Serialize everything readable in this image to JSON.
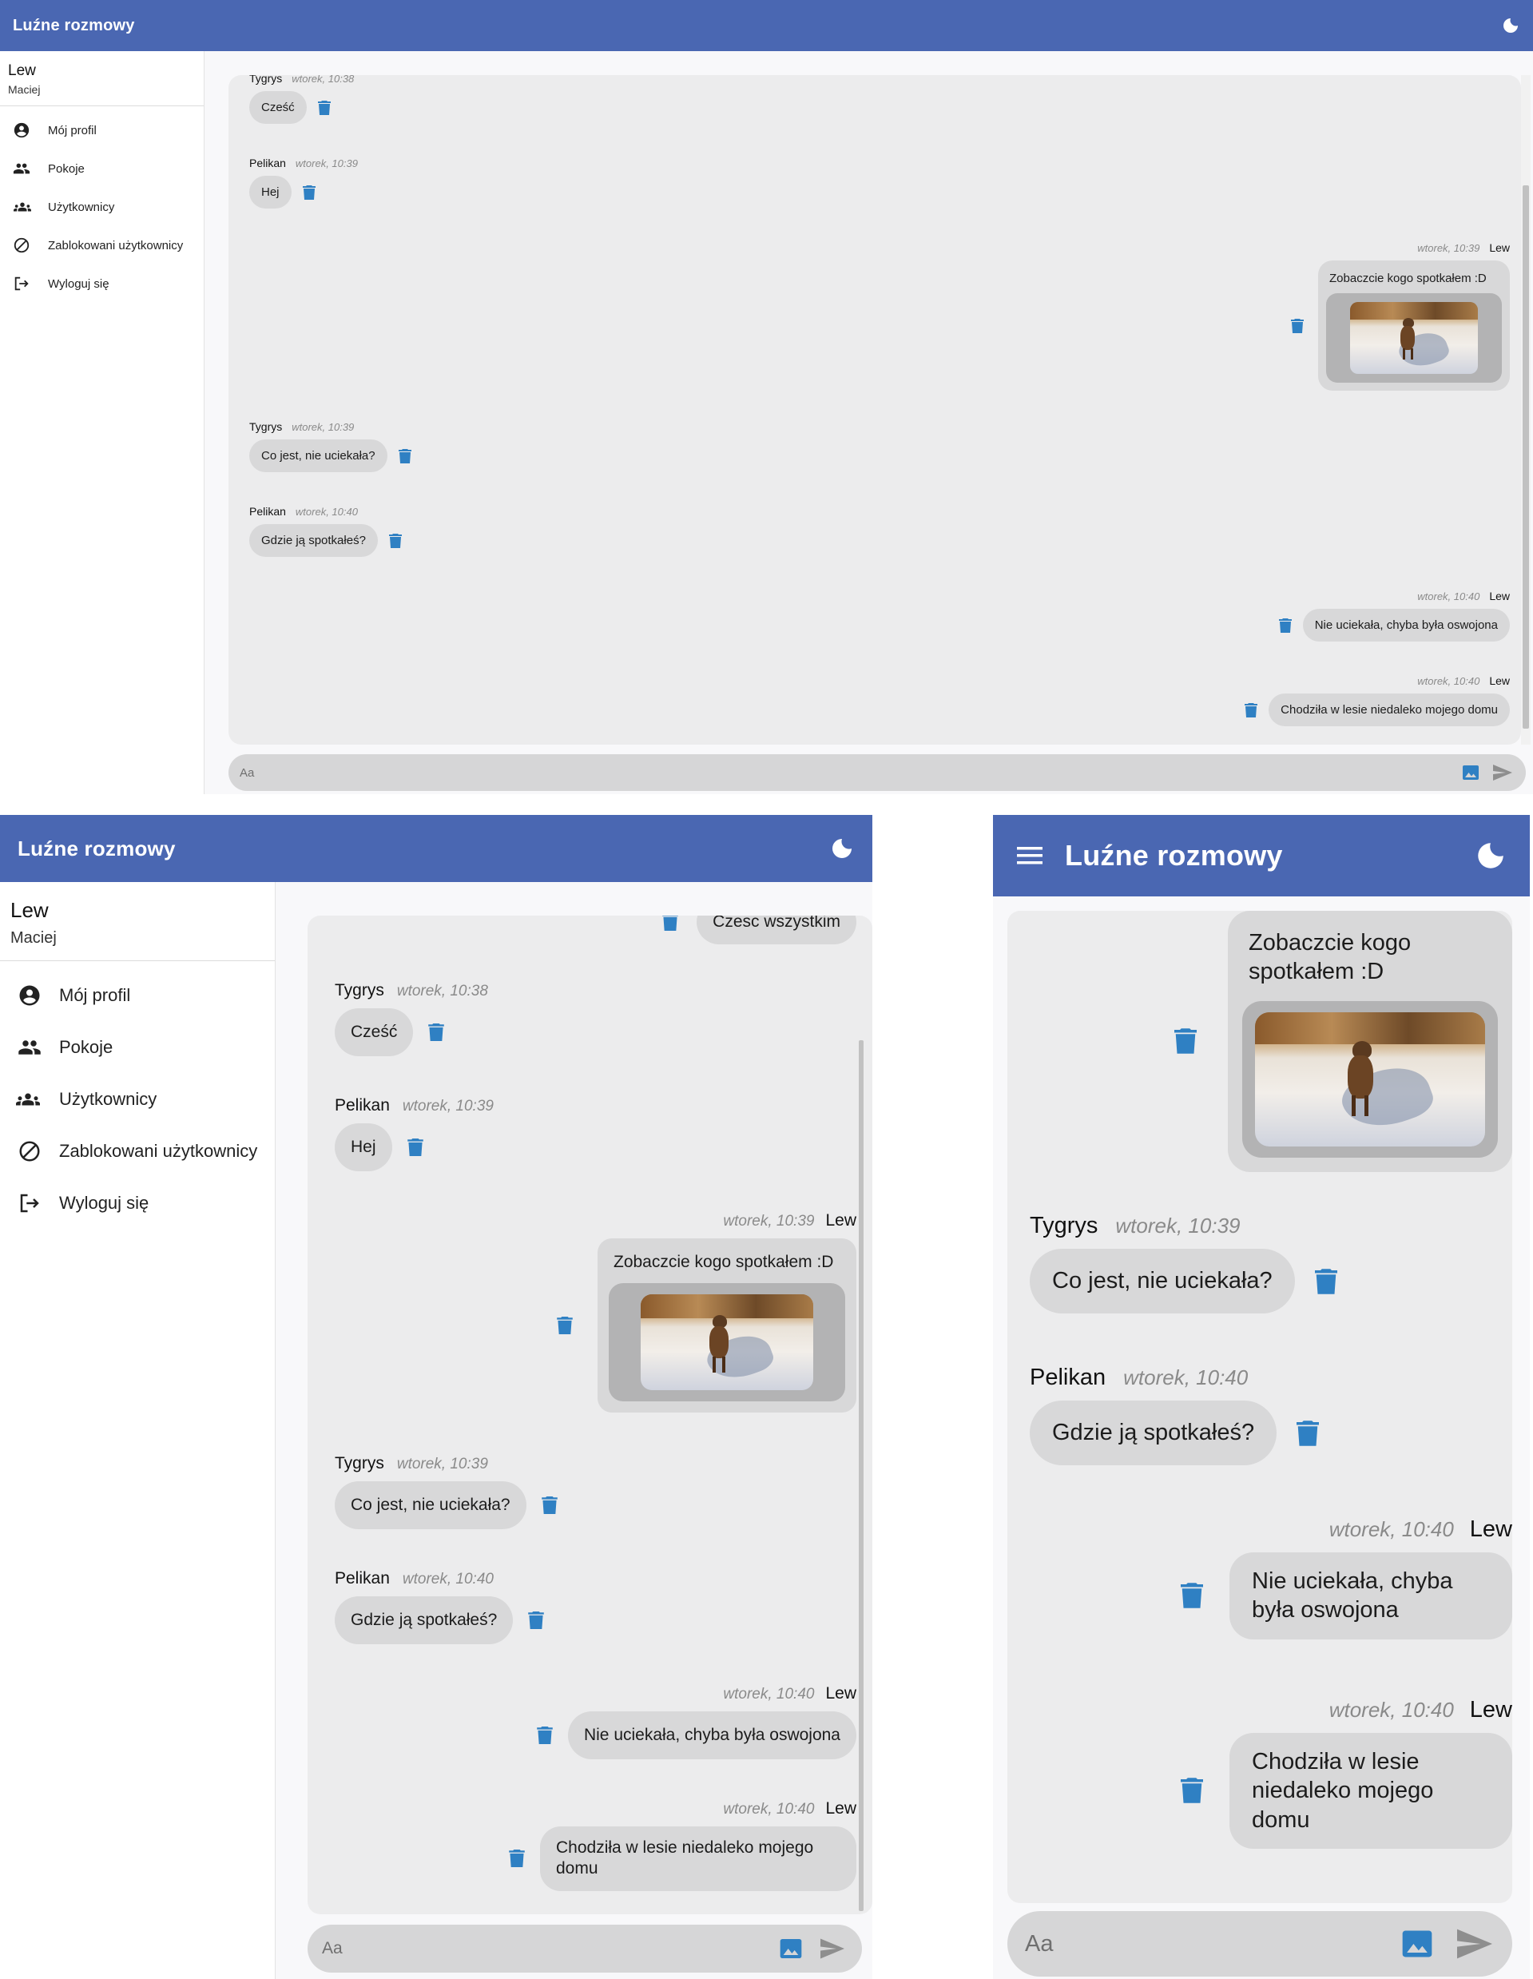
{
  "app": {
    "title": "Luźne rozmowy"
  },
  "user": {
    "name": "Lew",
    "subtitle": "Maciej"
  },
  "menu": [
    {
      "label": "Mój profil",
      "icon": "account-circle-icon"
    },
    {
      "label": "Pokoje",
      "icon": "people-icon"
    },
    {
      "label": "Użytkownicy",
      "icon": "groups-icon"
    },
    {
      "label": "Zablokowani użytkownicy",
      "icon": "block-icon"
    },
    {
      "label": "Wyloguj się",
      "icon": "logout-icon"
    }
  ],
  "messages": [
    {
      "author": "",
      "time": "",
      "text": "Czesc wszystkim",
      "side": "right"
    },
    {
      "author": "Tygrys",
      "time": "wtorek, 10:38",
      "text": "Cześć",
      "side": "left"
    },
    {
      "author": "Pelikan",
      "time": "wtorek, 10:39",
      "text": "Hej",
      "side": "left"
    },
    {
      "author": "Lew",
      "time": "wtorek, 10:39",
      "text": "Zobaczcie kogo spotkałem :D",
      "side": "right",
      "image": "dog-in-snow-photo"
    },
    {
      "author": "Tygrys",
      "time": "wtorek, 10:39",
      "text": "Co jest, nie uciekała?",
      "side": "left"
    },
    {
      "author": "Pelikan",
      "time": "wtorek, 10:40",
      "text": "Gdzie ją spotkałeś?",
      "side": "left"
    },
    {
      "author": "Lew",
      "time": "wtorek, 10:40",
      "text": "Nie uciekała, chyba była oswojona",
      "side": "right"
    },
    {
      "author": "Lew",
      "time": "wtorek, 10:40",
      "text": "Chodziła w lesie niedaleko mojego domu",
      "side": "right"
    }
  ],
  "composer": {
    "placeholder": "Aa"
  },
  "colors": {
    "appbar": "#4a67b2",
    "accent": "#2f80c3",
    "chat_bg": "#ececed",
    "bubble": "#d8d8d9",
    "photo_frame": "#b3b3b4"
  }
}
